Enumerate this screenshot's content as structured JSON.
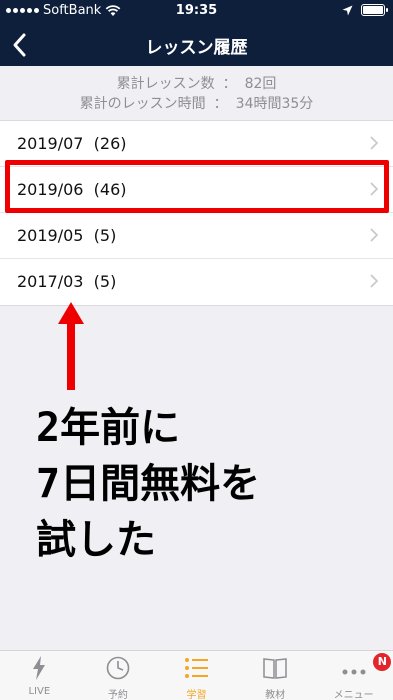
{
  "status_bar": {
    "carrier": "SoftBank",
    "time": "19:35",
    "wifi_icon": "wifi-icon",
    "location_icon": "location-arrow-icon",
    "battery_icon": "battery-icon",
    "battery_level": 1.0
  },
  "navbar": {
    "title": "レッスン履歴",
    "back_icon": "chevron-left-icon"
  },
  "summary": {
    "total_lessons_label": "累計レッスン数",
    "total_lessons_value": "82回",
    "total_time_label": "累計のレッスン時間",
    "total_time_value": "34時間35分",
    "separator": "："
  },
  "history": [
    {
      "label": "2019/07  (26)"
    },
    {
      "label": "2019/06  (46)"
    },
    {
      "label": "2019/05  (5)"
    },
    {
      "label": "2017/03  (5)"
    }
  ],
  "annotation": {
    "highlight_color": "#ef0000",
    "arrow_color": "#ef0000",
    "lines": [
      "2年前に",
      "7日間無料を",
      "試した"
    ]
  },
  "tabbar": {
    "tabs": [
      {
        "label": "LIVE",
        "icon": "lightning-icon"
      },
      {
        "label": "予約",
        "icon": "clock-icon"
      },
      {
        "label": "学習",
        "icon": "list-icon",
        "active": true
      },
      {
        "label": "教材",
        "icon": "book-icon"
      },
      {
        "label": "メニュー",
        "icon": "more-dots-icon",
        "badge": "N"
      }
    ],
    "active_color": "#f5a623"
  }
}
